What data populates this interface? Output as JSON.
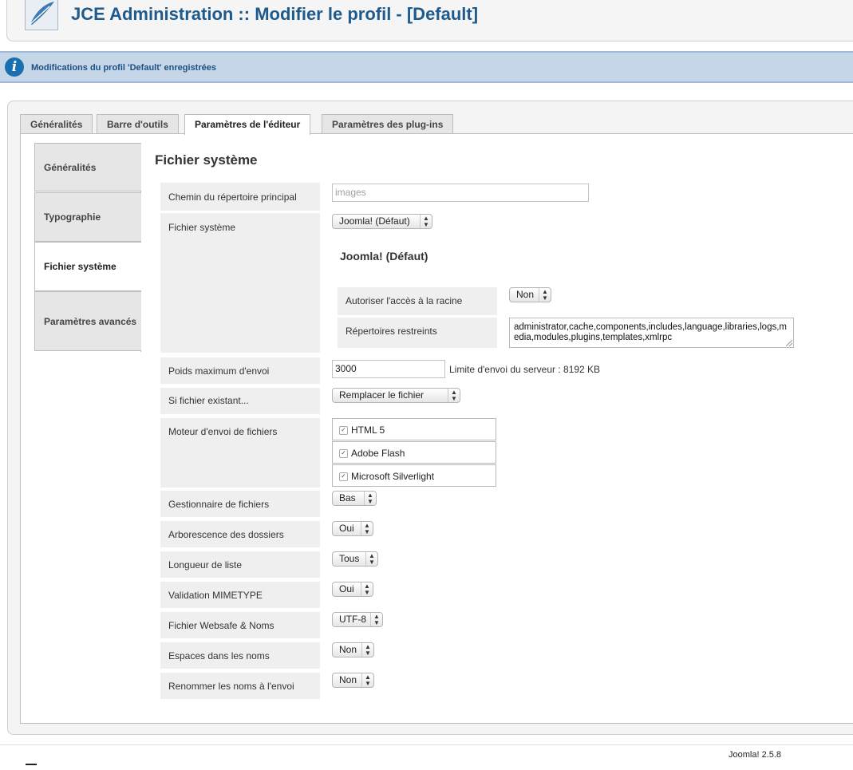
{
  "header": {
    "title": "JCE Administration :: Modifier le profil - [Default]",
    "logo_icon": "feather-logo-icon"
  },
  "message": {
    "text": "Modifications du profil 'Default' enregistrées",
    "icon": "info-icon"
  },
  "tabs": [
    {
      "label": "Généralités"
    },
    {
      "label": "Barre d'outils"
    },
    {
      "label": "Paramètres de l'éditeur"
    },
    {
      "label": "Paramètres des plug-ins"
    }
  ],
  "active_tab": "Paramètres de l'éditeur",
  "side_tabs": [
    {
      "label": "Généralités"
    },
    {
      "label": "Typographie"
    },
    {
      "label": "Fichier système"
    },
    {
      "label": "Paramètres avancés"
    }
  ],
  "section": {
    "title": "Fichier système",
    "fields": {
      "root_dir": {
        "label": "Chemin du répertoire principal",
        "placeholder": "images"
      },
      "filesystem": {
        "label": "Fichier système",
        "value": "Joomla! (Défaut)"
      },
      "joomla_sub": {
        "title": "Joomla! (Défaut)",
        "allow_root": {
          "label": "Autoriser l'accès à la racine",
          "value": "Non"
        },
        "restricted": {
          "label": "Répertoires restreints",
          "value": "administrator,cache,components,includes,language,libraries,logs,media,modules,plugins,templates,xmlrpc"
        }
      },
      "max_upload": {
        "label": "Poids maximum d'envoi",
        "value": "3000",
        "limit_text": "Limite d'envoi du serveur : 8192 KB"
      },
      "file_exists": {
        "label": "Si fichier existant...",
        "value": "Remplacer le fichier"
      },
      "upload_engine": {
        "label": "Moteur d'envoi de fichiers",
        "options": [
          {
            "label": "HTML 5",
            "checked": true
          },
          {
            "label": "Adobe Flash",
            "checked": true
          },
          {
            "label": "Microsoft Silverlight",
            "checked": true
          }
        ]
      },
      "file_manager": {
        "label": "Gestionnaire de fichiers",
        "value": "Bas"
      },
      "folder_tree": {
        "label": "Arborescence des dossiers",
        "value": "Oui"
      },
      "list_length": {
        "label": "Longueur de liste",
        "value": "Tous"
      },
      "mimetype": {
        "label": "Validation MIMETYPE",
        "value": "Oui"
      },
      "websafe": {
        "label": "Fichier Websafe & Noms",
        "value": "UTF-8"
      },
      "spaces": {
        "label": "Espaces dans les noms",
        "value": "Non"
      },
      "rename": {
        "label": "Renommer les noms à l'envoi",
        "value": "Non"
      }
    }
  },
  "footer": {
    "version": "Joomla! 2.5.8"
  }
}
